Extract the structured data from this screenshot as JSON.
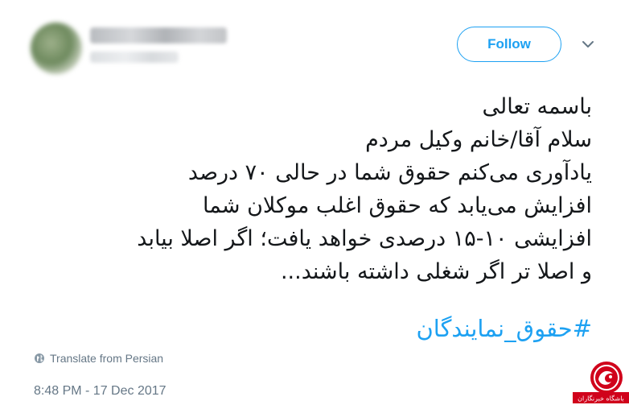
{
  "tweet": {
    "follow_label": "Follow",
    "lines": [
      "باسمه تعالی",
      "سلام آقا/خانم وکیل مردم",
      "یادآوری می‌کنم حقوق شما در حالی ۷۰ درصد",
      "افزایش می‌یابد که حقوق اغلب موکلان شما",
      "افزایشی ۱۰-۱۵ درصدی خواهد یافت؛ اگر اصلا بیابد",
      "و اصلا تر اگر شغلی داشته باشند..."
    ],
    "hashtag": "#حقوق_نمایندگان",
    "translate_label": "Translate from Persian",
    "timestamp": "8:48 PM - 17 Dec 2017"
  },
  "watermark": {
    "text": "باشگاه خبرنگاران",
    "accent": "#d0021b"
  },
  "colors": {
    "link": "#1da1f2",
    "text": "#14171a",
    "meta": "#657786"
  }
}
